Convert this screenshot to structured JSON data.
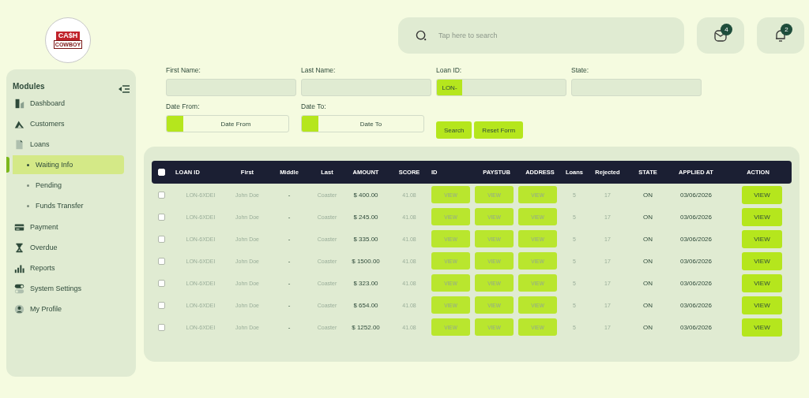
{
  "logo": {
    "line_1": "CA$H",
    "line_2": "COWBOY"
  },
  "search": {
    "placeholder": "Tap here to search"
  },
  "messages": {
    "count": "4"
  },
  "notifications": {
    "count": "2"
  },
  "sidebar": {
    "title": "Modules",
    "items": [
      {
        "label": "Dashboard",
        "selected": false
      },
      {
        "label": "Customers",
        "selected": false
      },
      {
        "label": "Loans",
        "selected": false,
        "children": [
          {
            "label": "Waiting Info",
            "selected": true
          },
          {
            "label": "Pending",
            "selected": false
          },
          {
            "label": "Funds Transfer",
            "selected": false
          }
        ]
      },
      {
        "label": "Payment",
        "selected": false
      },
      {
        "label": "Overdue",
        "selected": false
      },
      {
        "label": "Reports",
        "selected": false
      },
      {
        "label": "System Settings",
        "selected": false
      },
      {
        "label": "My Profile",
        "selected": false
      }
    ]
  },
  "filters": [
    {
      "kind": "text",
      "label": "First Name:"
    },
    {
      "kind": "text",
      "label": "Last Name:"
    },
    {
      "kind": "prefixed",
      "label": "Loan ID:",
      "prefix": "LON-"
    },
    {
      "kind": "text",
      "label": "State:"
    },
    {
      "kind": "date",
      "label": "Date From:",
      "placeholder": "Date From"
    },
    {
      "kind": "date",
      "label": "Date To:",
      "placeholder": "Date To"
    }
  ],
  "filter_buttons": [
    "Search",
    "Reset Form"
  ],
  "table": {
    "all_checked": false,
    "columns": [
      {
        "label": "LOAN ID",
        "kind": "faded"
      },
      {
        "label": "First",
        "kind": "faded"
      },
      {
        "label": "Middle",
        "kind": "text"
      },
      {
        "label": "Last",
        "kind": "faded"
      },
      {
        "label": "AMOUNT",
        "kind": "text"
      },
      {
        "label": "SCORE",
        "kind": "faded"
      },
      {
        "label": "ID",
        "kind": "faded-button"
      },
      {
        "label": "PAYSTUB",
        "kind": "faded-button"
      },
      {
        "label": "ADDRESS",
        "kind": "faded-button"
      },
      {
        "label": "Loans",
        "kind": "faded"
      },
      {
        "label": "Rejected",
        "kind": "faded"
      },
      {
        "label": "STATE",
        "kind": "text"
      },
      {
        "label": "APPLIED AT",
        "kind": "text"
      },
      {
        "label": "ACTION",
        "kind": "button"
      }
    ],
    "rows": [
      {
        "checked": false,
        "cells": [
          "LON-6XDEI",
          "John Doe",
          "-",
          "Coaster",
          "$ 400.00",
          "41.08",
          "VIEW",
          "VIEW",
          "VIEW",
          "5",
          "17",
          "ON",
          "03/06/2026",
          "VIEW"
        ]
      },
      {
        "checked": false,
        "cells": [
          "LON-6XDEI",
          "John Doe",
          "-",
          "Coaster",
          "$ 245.00",
          "41.08",
          "VIEW",
          "VIEW",
          "VIEW",
          "5",
          "17",
          "ON",
          "03/06/2026",
          "VIEW"
        ]
      },
      {
        "checked": false,
        "cells": [
          "LON-6XDEI",
          "John Doe",
          "-",
          "Coaster",
          "$ 335.00",
          "41.08",
          "VIEW",
          "VIEW",
          "VIEW",
          "5",
          "17",
          "ON",
          "03/06/2026",
          "VIEW"
        ]
      },
      {
        "checked": false,
        "cells": [
          "LON-6XDEI",
          "John Doe",
          "-",
          "Coaster",
          "$ 1500.00",
          "41.08",
          "VIEW",
          "VIEW",
          "VIEW",
          "5",
          "17",
          "ON",
          "03/06/2026",
          "VIEW"
        ]
      },
      {
        "checked": false,
        "cells": [
          "LON-6XDEI",
          "John Doe",
          "-",
          "Coaster",
          "$ 323.00",
          "41.08",
          "VIEW",
          "VIEW",
          "VIEW",
          "5",
          "17",
          "ON",
          "03/06/2026",
          "VIEW"
        ]
      },
      {
        "checked": false,
        "cells": [
          "LON-6XDEI",
          "John Doe",
          "-",
          "Coaster",
          "$ 654.00",
          "41.08",
          "VIEW",
          "VIEW",
          "VIEW",
          "5",
          "17",
          "ON",
          "03/06/2026",
          "VIEW"
        ]
      },
      {
        "checked": false,
        "cells": [
          "LON-6XDEI",
          "John Doe",
          "-",
          "Coaster",
          "$ 1252.00",
          "41.08",
          "VIEW",
          "VIEW",
          "VIEW",
          "5",
          "17",
          "ON",
          "03/06/2026",
          "VIEW"
        ]
      }
    ]
  }
}
